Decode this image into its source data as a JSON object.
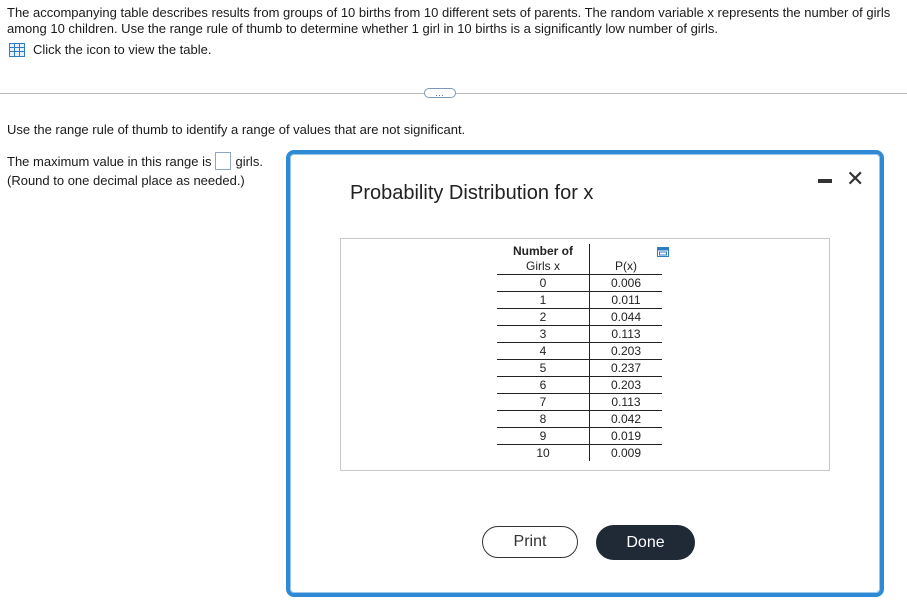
{
  "intro": {
    "text": "The accompanying table describes results from groups of 10 births from 10 different sets of parents. The random variable x represents the number of girls among 10 children. Use the range rule of thumb to determine whether 1 girl in 10 births is a significantly low number of girls.",
    "link_label": "Click the icon to view the table.",
    "link_icon": "table-icon"
  },
  "expand_label": "…",
  "question": {
    "instruction": "Use the range rule of thumb to identify a range of values that are not significant.",
    "prefix": "The maximum value in this range is",
    "answer_value": "",
    "suffix": "girls.",
    "note": "(Round to one decimal place as needed.)"
  },
  "dialog": {
    "title": "Probability Distribution for x",
    "minimize_icon": "minimize-icon",
    "close_icon": "close-icon",
    "copy_icon": "copy-icon",
    "table": {
      "header_x_line1": "Number of",
      "header_x_line2": "Girls x",
      "header_p": "P(x)",
      "rows": [
        {
          "x": "0",
          "p": "0.006"
        },
        {
          "x": "1",
          "p": "0.011"
        },
        {
          "x": "2",
          "p": "0.044"
        },
        {
          "x": "3",
          "p": "0.113"
        },
        {
          "x": "4",
          "p": "0.203"
        },
        {
          "x": "5",
          "p": "0.237"
        },
        {
          "x": "6",
          "p": "0.203"
        },
        {
          "x": "7",
          "p": "0.113"
        },
        {
          "x": "8",
          "p": "0.042"
        },
        {
          "x": "9",
          "p": "0.019"
        },
        {
          "x": "10",
          "p": "0.009"
        }
      ]
    },
    "print_label": "Print",
    "done_label": "Done"
  }
}
